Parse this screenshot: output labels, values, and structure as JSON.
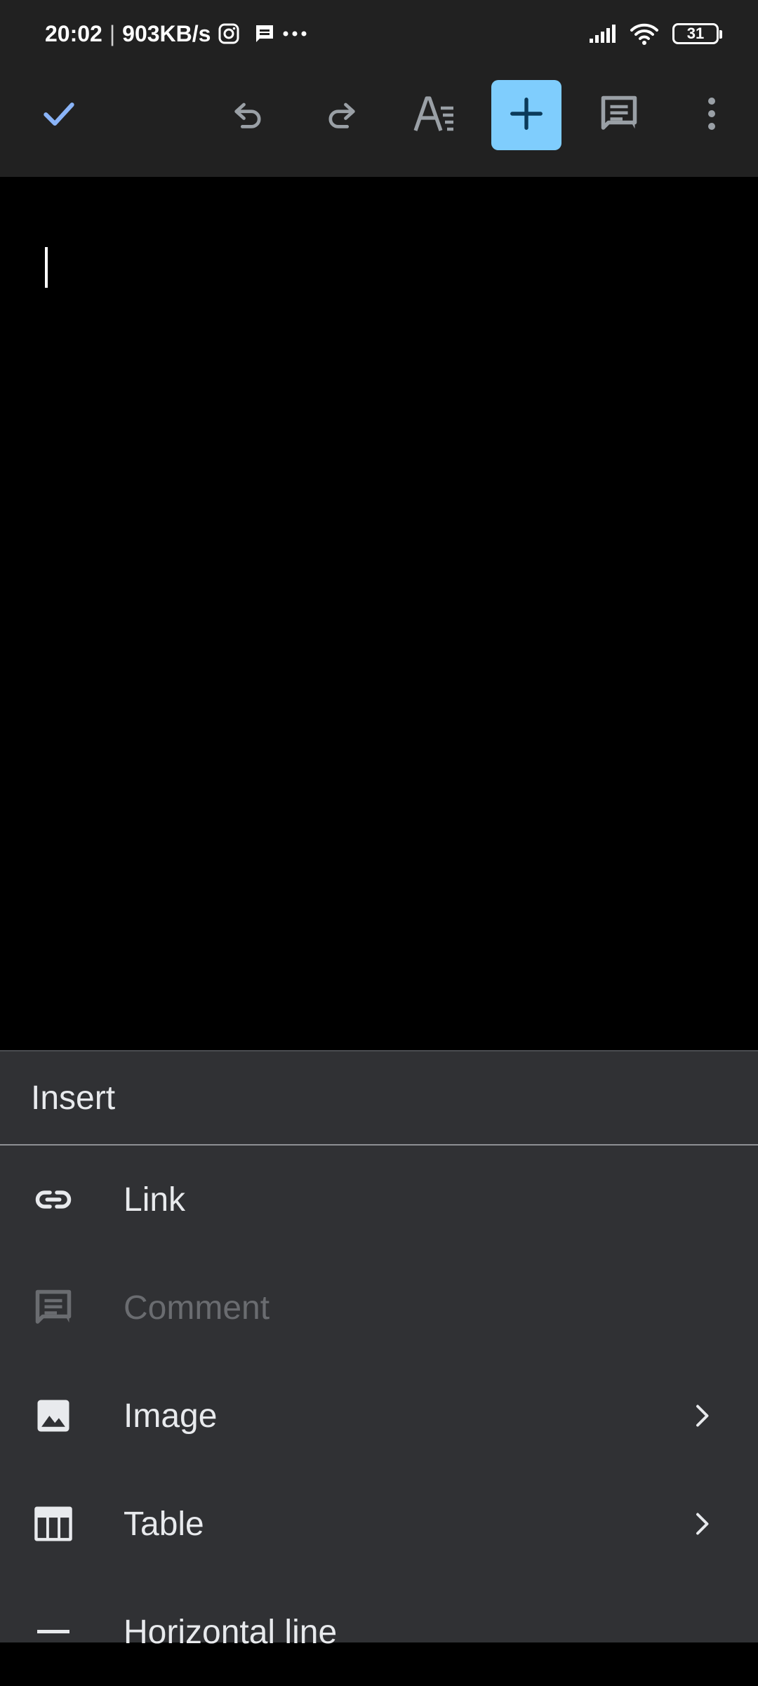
{
  "status_bar": {
    "time": "20:02",
    "separator": "|",
    "network_speed": "903KB/s",
    "notification_icons": [
      "instagram-icon",
      "message-icon",
      "more-dots-icon"
    ],
    "battery_level": "31",
    "signal_icon": "cellular-signal-icon",
    "wifi_icon": "wifi-icon"
  },
  "toolbar": {
    "buttons": [
      {
        "name": "done",
        "icon": "check-icon",
        "color": "#8ab4f8"
      },
      {
        "name": "undo",
        "icon": "undo-icon"
      },
      {
        "name": "redo",
        "icon": "redo-icon"
      },
      {
        "name": "format",
        "icon": "text-format-icon"
      },
      {
        "name": "insert",
        "icon": "plus-icon",
        "active": true,
        "color": "#7fcdfd"
      },
      {
        "name": "comment",
        "icon": "comment-icon"
      },
      {
        "name": "more",
        "icon": "more-vert-icon"
      }
    ]
  },
  "document": {
    "content": ""
  },
  "insert_sheet": {
    "title": "Insert",
    "items": [
      {
        "label": "Link",
        "icon": "link-icon",
        "enabled": true,
        "has_submenu": false
      },
      {
        "label": "Comment",
        "icon": "comment-icon",
        "enabled": false,
        "has_submenu": false
      },
      {
        "label": "Image",
        "icon": "image-icon",
        "enabled": true,
        "has_submenu": true
      },
      {
        "label": "Table",
        "icon": "table-icon",
        "enabled": true,
        "has_submenu": true
      },
      {
        "label": "Horizontal line",
        "icon": "horizontal-line-icon",
        "enabled": true,
        "has_submenu": false
      }
    ]
  },
  "colors": {
    "toolbar_bg": "#212121",
    "document_bg": "#000000",
    "sheet_bg": "#303134",
    "accent": "#7fcdfd",
    "check": "#8ab4f8",
    "text": "#e8eaed",
    "disabled_text": "#6a6c70",
    "icon_gray": "#9aa0a6"
  }
}
